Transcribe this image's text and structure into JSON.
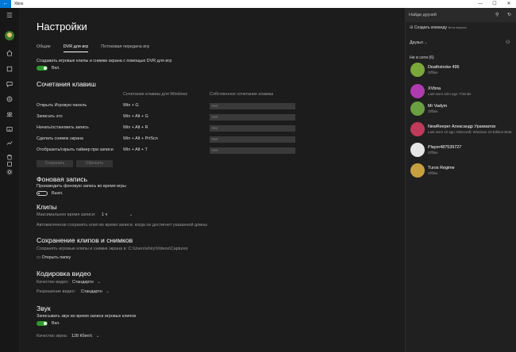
{
  "window": {
    "title": "Xbox",
    "back": "←",
    "min": "—",
    "max": "☐",
    "close": "✕"
  },
  "main": {
    "title": "Настройки",
    "tabs": [
      {
        "label": "Общие"
      },
      {
        "label": "DVR для игр"
      },
      {
        "label": "Потоковая передача игр"
      }
    ],
    "dvr_toggle_label": "Создавать игровые клипы и снимки экрана с помощью DVR для игр",
    "dvr_toggle_state": "Вкл.",
    "shortcuts": {
      "title": "Сочетания клавиш",
      "col_default": "Сочетание клавиш для Windows",
      "col_custom": "Собственное сочетание клавиш",
      "rows": [
        {
          "action": "Открыть Игровую панель",
          "keys": "Win + G",
          "custom": "Нет"
        },
        {
          "action": "Записать это",
          "keys": "Win + Alt + G",
          "custom": "Нет"
        },
        {
          "action": "Начать/остановить запись",
          "keys": "Win + Alt + R",
          "custom": "Нет"
        },
        {
          "action": "Сделать снимок экрана",
          "keys": "Win + Alt + PrtScn",
          "custom": "Нет"
        },
        {
          "action": "Отобразить/скрыть таймер при записи",
          "keys": "Win + Alt + T",
          "custom": "Нет"
        }
      ],
      "save": "Сохранить",
      "reset": "Сбросить"
    },
    "background": {
      "title": "Фоновая запись",
      "label": "Производить фоновую запись во время игры",
      "state": "Выкл."
    },
    "clips": {
      "title": "Клипы",
      "max_label": "Максимальное время записи:",
      "max_value": "1 ч",
      "note": "Автоматически сохранять клип во время записи, когда он достигнет указанной длины"
    },
    "saving": {
      "title": "Сохранение клипов и снимков",
      "path_label": "Сохранять игровые клипы и снимки экрана в: C:\\Users\\shiry\\Videos\\Captures",
      "open_folder": "Открыть папку"
    },
    "encoding": {
      "title": "Кодировка видео",
      "quality_label": "Качество видео:",
      "quality_value": "Стандартн",
      "resolution_label": "Разрешение видео:",
      "resolution_value": "Стандартн"
    },
    "audio": {
      "title": "Звук",
      "label": "Записывать звук во время записи игровых клипов",
      "state": "Вкл.",
      "quality_label": "Качество звука:",
      "quality_value": "128 Кбит/с"
    }
  },
  "panel": {
    "search_placeholder": "Найди друзей",
    "create_club": "Создать команду",
    "create_club_badge": "Бета-версия",
    "friends_dropdown": "Друзья",
    "online_header": "Не в сети (6)",
    "friends": [
      {
        "name": "Deathstroke 495",
        "status": "Offline",
        "color": "#7aa83a"
      },
      {
        "name": "XVbna",
        "status": "Last seen 42m ago: Friends",
        "color": "#b03ab0"
      },
      {
        "name": "Mr Vadym",
        "status": "Offline",
        "color": "#6aa040"
      },
      {
        "name": "NewReeper  Александр Урахматов",
        "status": "Last seen 1h ago: Minecraft: Windows 10 Edition Beta",
        "color": "#c03a5a"
      },
      {
        "name": "Player487539727",
        "status": "Offline",
        "color": "#e6e6e6"
      },
      {
        "name": "Turos Regime",
        "status": "Offline",
        "color": "#c8a040"
      }
    ]
  }
}
